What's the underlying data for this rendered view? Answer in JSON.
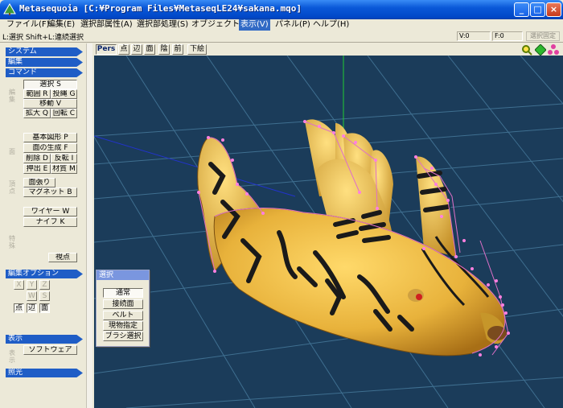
{
  "window": {
    "title": "Metasequoia [C:¥Program Files¥MetaseqLE24¥sakana.mqo]"
  },
  "menubar": {
    "items": [
      {
        "label": "ファイル(F)",
        "active": false
      },
      {
        "label": "編集(E)",
        "active": false
      },
      {
        "label": "選択部属性(A)",
        "active": false
      },
      {
        "label": "選択部処理(S)",
        "active": false
      },
      {
        "label": "オブジェクト(O)",
        "active": false
      },
      {
        "label": "表示(V)",
        "active": true
      },
      {
        "label": "パネル(P)",
        "active": false
      },
      {
        "label": "ヘルプ(H)",
        "active": false
      }
    ]
  },
  "statusbar": {
    "hint": "L:選択  Shift+L:連続選択",
    "v_count": "V:0",
    "f_count": "F:0",
    "lock_button": "選択固定"
  },
  "leftpanel": {
    "sections": {
      "system": "システム",
      "edit": "編集",
      "command": "コマンド",
      "edit_option": "編集オプション",
      "display": "表示",
      "lighting": "照光"
    },
    "group_labels": {
      "edit": "編集",
      "face": "面",
      "vertex": "頂点",
      "special": "特殊",
      "display": "表示"
    },
    "edit_tools": {
      "select": "選択 S",
      "range": "範囲 R",
      "lasso": "投縄 G",
      "move": "移動 V",
      "scale": "拡大 Q",
      "rotate": "回転 C"
    },
    "face_tools": {
      "basic_shape": "基本図形 P",
      "face_gen": "面の生成 F",
      "delete": "削除 D",
      "flip": "反転 I",
      "extrude": "押出 E",
      "material": "材質 M"
    },
    "vertex_tools": {
      "stretch": "面張り",
      "magnet": "マグネット B"
    },
    "special_tools": {
      "wire": "ワイヤー W",
      "knife": "ナイフ K"
    },
    "viewpoint": "視点",
    "axis_buttons": {
      "x": "X",
      "y": "Y",
      "z": "Z",
      "w": "W",
      "s": "S"
    },
    "mode_buttons": {
      "point": "点",
      "edge": "辺",
      "face": "面"
    },
    "display_button": "ソフトウェア"
  },
  "viewport_toolbar": {
    "buttons": [
      "Pers",
      "点",
      "辺",
      "面",
      "陰",
      "前",
      "下絵"
    ]
  },
  "select_panel": {
    "title": "選択",
    "buttons": [
      "通常",
      "接続面",
      "ベルト",
      "現物指定",
      "ブラシ選択"
    ]
  },
  "colors": {
    "viewport_bg": "#1b3c5a",
    "grid": "#3f6f90",
    "fish_body": "#e8b23b",
    "stripe": "#1a1a1a",
    "wire": "#e070c8",
    "y_axis": "#22cc33",
    "x_axis": "#2233cc"
  }
}
